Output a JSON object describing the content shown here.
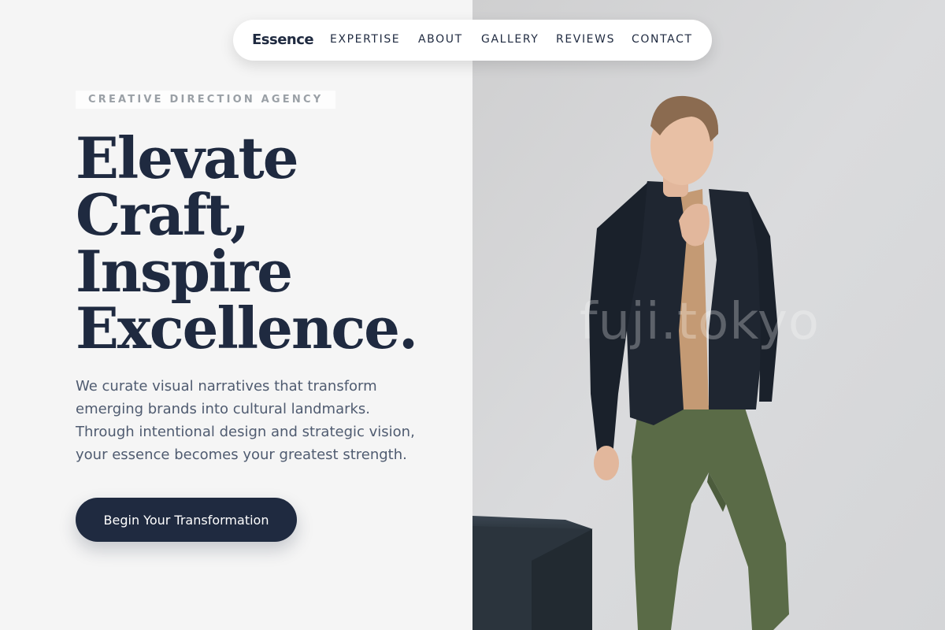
{
  "nav": {
    "brand": "Essence",
    "links": [
      "EXPERTISE",
      "ABOUT",
      "GALLERY",
      "REVIEWS",
      "CONTACT"
    ]
  },
  "hero": {
    "eyebrow": "CREATIVE DIRECTION AGENCY",
    "headline_lines": [
      "Elevate",
      "Craft,",
      "Inspire",
      "Excellence."
    ],
    "lede_lines": [
      "We curate visual narratives that transform",
      "emerging brands into cultural landmarks.",
      "Through intentional design and strategic vision,",
      "your essence becomes your greatest strength."
    ],
    "cta_label": "Begin Your Transformation"
  },
  "photo": {
    "watermark": "fuji.tokyo"
  },
  "colors": {
    "brand_navy": "#1f2a40",
    "left_background": "#f5f5f5",
    "muted_text": "#4f5b70",
    "eyebrow_text": "#9aa0a6",
    "pants_green": "#5a6b47",
    "jacket_dark": "#1e2530",
    "tee_tan": "#c49a74"
  }
}
